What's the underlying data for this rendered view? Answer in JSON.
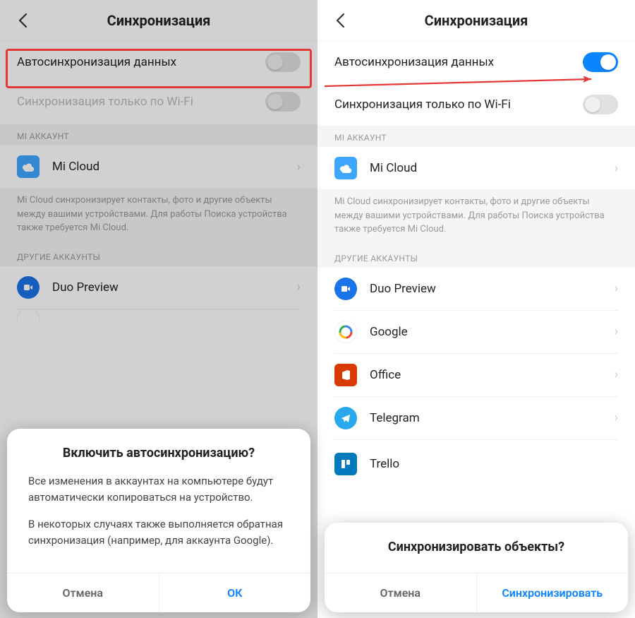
{
  "header": {
    "title": "Синхронизация"
  },
  "rows": {
    "autosync": "Автосинхронизация данных",
    "wifiOnly": "Синхронизация только по Wi-Fi"
  },
  "sections": {
    "miAccount": "MI АККАУНТ",
    "otherAccounts": "ДРУГИЕ АККАУНТЫ"
  },
  "miCloud": {
    "label": "Mi Cloud",
    "desc": "Mi Cloud синхронизирует контакты, фото и другие объекты между вашими устройствами. Для работы Поиска устройства также требуется Mi Cloud."
  },
  "accounts": {
    "duo": "Duo Preview",
    "google": "Google",
    "office": "Office",
    "telegram": "Telegram",
    "trello": "Trello"
  },
  "dialog1": {
    "title": "Включить автосинхронизацию?",
    "p1": "Все изменения в аккаунтах на компьютере будут автоматически копироваться на устройство.",
    "p2": "В некоторых случаях также выполняется обратная синхронизация (например, для аккаунта Google).",
    "cancel": "Отмена",
    "ok": "ОК"
  },
  "dialog2": {
    "title": "Синхронизировать объекты?",
    "cancel": "Отмена",
    "ok": "Синхронизировать"
  }
}
